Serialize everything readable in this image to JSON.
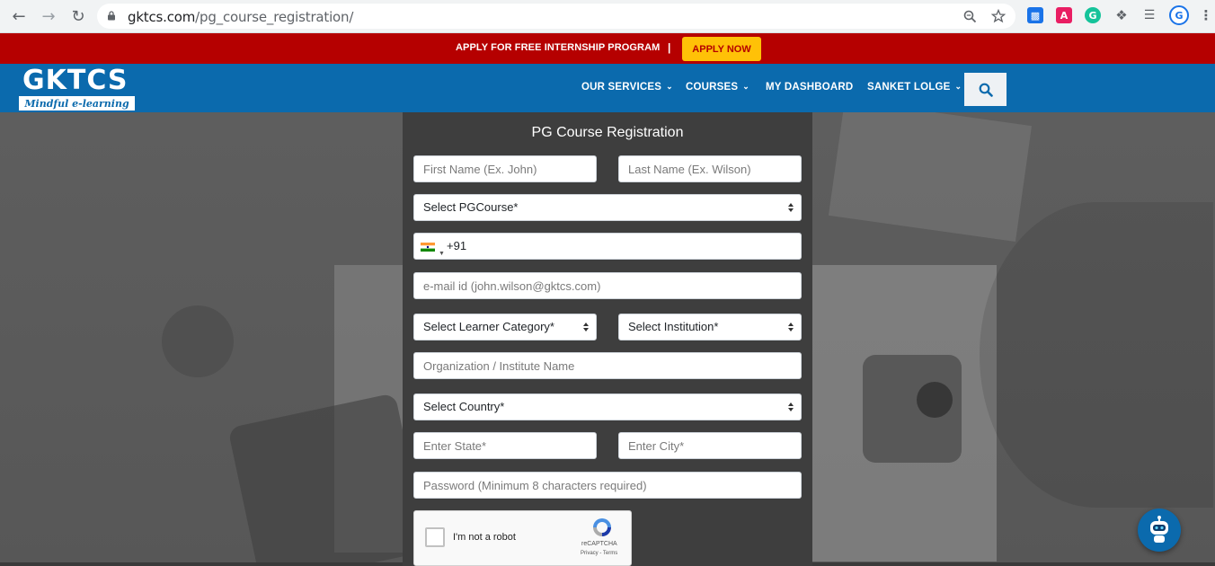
{
  "browser": {
    "url_host": "gktcs.com",
    "url_path": "/pg_course_registration/",
    "icons": [
      "back-icon",
      "forward-icon",
      "reload-icon",
      "lock-icon",
      "zoom-icon",
      "star-icon",
      "extensions-icon"
    ]
  },
  "promo": {
    "text": "APPLY FOR FREE INTERNSHIP PROGRAM",
    "separator": "|",
    "button": "APPLY NOW"
  },
  "header": {
    "logo": "GKTCS",
    "tagline": "Mindful e-learning",
    "nav": [
      {
        "label": "OUR SERVICES",
        "dropdown": true
      },
      {
        "label": "COURSES",
        "dropdown": true
      },
      {
        "label": "MY DASHBOARD",
        "dropdown": false
      },
      {
        "label": "SANKET LOLGE",
        "dropdown": true
      }
    ]
  },
  "form": {
    "title": "PG Course Registration",
    "first_name_placeholder": "First Name (Ex. John)",
    "last_name_placeholder": "Last Name (Ex. Wilson)",
    "pg_course_select": "Select PGCourse*",
    "phone_code": "+91",
    "email_placeholder": "e-mail id (john.wilson@gktcs.com)",
    "learner_category_select": "Select Learner Category*",
    "institution_select": "Select Institution*",
    "organization_placeholder": "Organization / Institute Name",
    "country_select": "Select Country*",
    "state_placeholder": "Enter State*",
    "city_placeholder": "Enter City*",
    "password_placeholder": "Password (Minimum 8 characters required)",
    "captcha": {
      "label": "I'm not a robot",
      "brand": "reCAPTCHA",
      "links": "Privacy - Terms"
    }
  },
  "colors": {
    "promo_bg": "#b50000",
    "apply_btn": "#ffc107",
    "header_bg": "#0b6aad",
    "form_bg": "#3e3e3e"
  }
}
